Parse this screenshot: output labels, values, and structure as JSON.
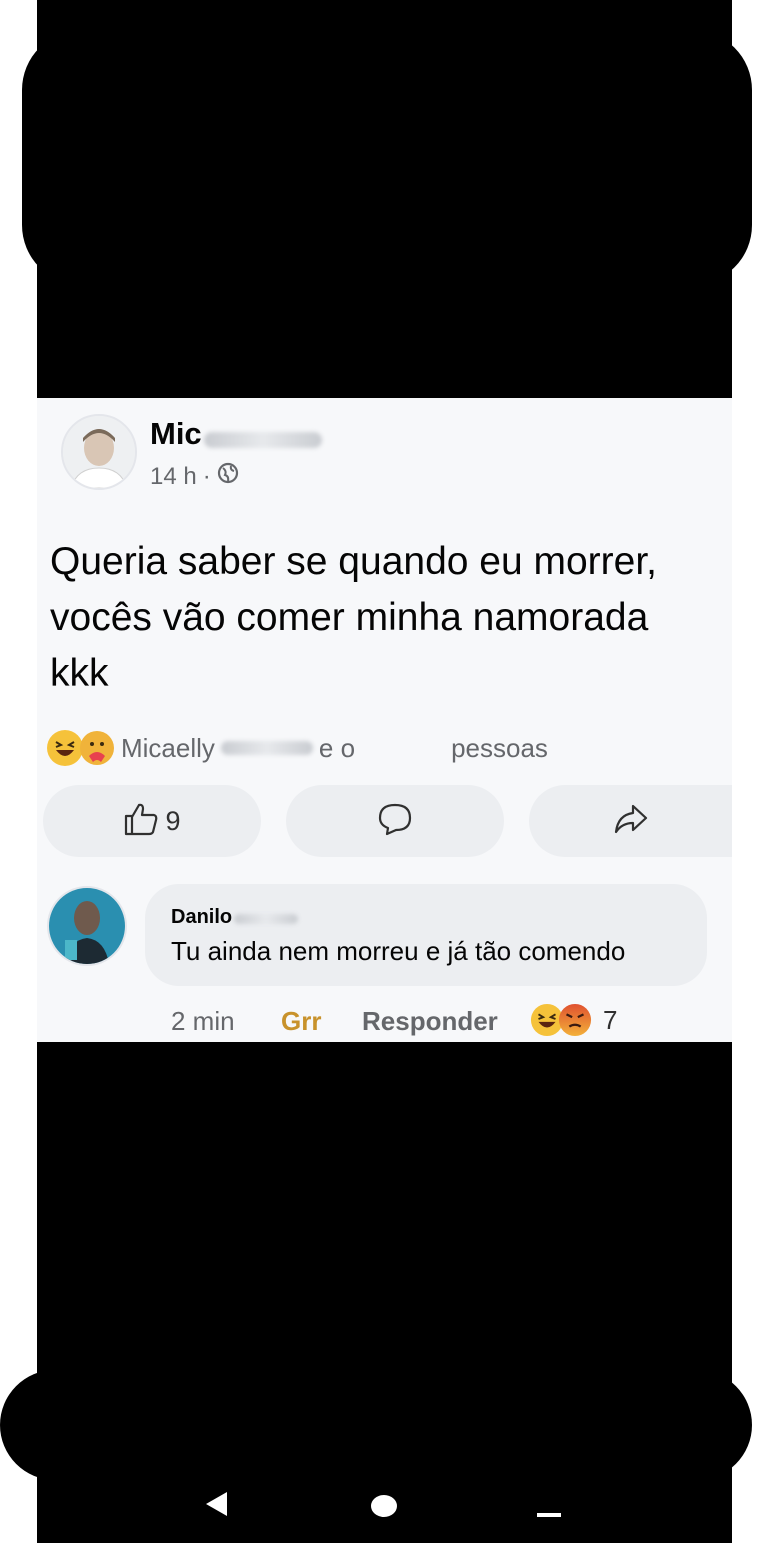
{
  "post": {
    "author_visible": "Mic",
    "time": "14 h",
    "separator": "·",
    "text_lines": [
      "Queria saber se quando eu morrer,",
      "vocês vão comer minha namorada",
      "kkk"
    ],
    "reactions": {
      "first_name": "Micaelly",
      "connector": "e o",
      "suffix": "pessoas"
    },
    "actions": {
      "like_count": "9"
    }
  },
  "comment": {
    "author_visible": "Danilo",
    "text": "Tu ainda nem morreu e já tão comendo",
    "time": "2 min",
    "reaction_label": "Grr",
    "reply_label": "Responder",
    "reaction_count": "7"
  },
  "colors": {
    "reaction_grr": "#c8922b",
    "meta_gray": "#65676b",
    "bubble_bg": "#eceef1"
  },
  "icons": [
    "globe-icon",
    "laugh-emoji-icon",
    "care-emoji-icon",
    "like-icon",
    "comment-icon",
    "share-icon",
    "angry-emoji-icon",
    "back-nav-icon",
    "home-nav-icon",
    "recents-nav-icon"
  ]
}
